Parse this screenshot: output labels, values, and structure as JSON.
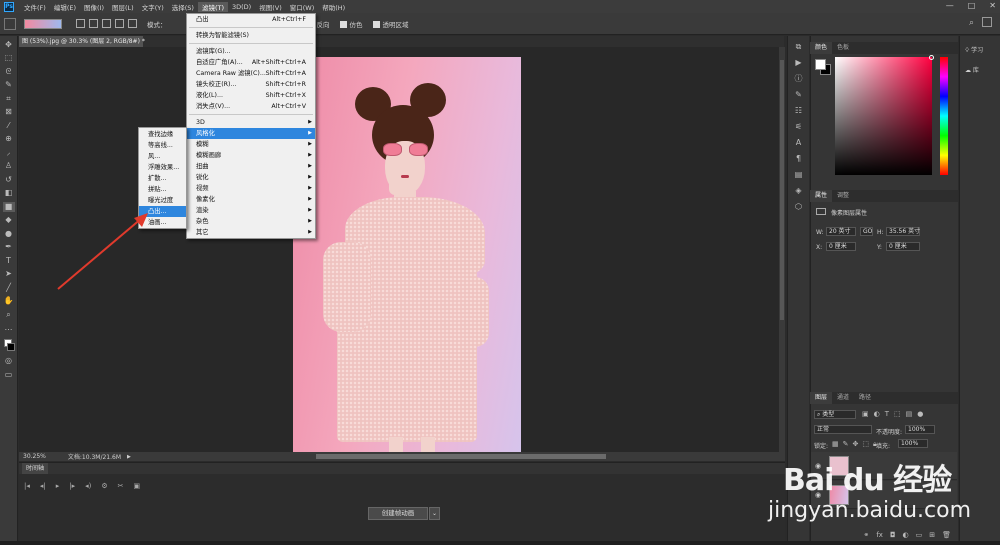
{
  "menubar": {
    "items": [
      "文件(F)",
      "编辑(E)",
      "图像(I)",
      "图层(L)",
      "文字(Y)",
      "选择(S)",
      "滤镜(T)",
      "3D(D)",
      "视图(V)",
      "窗口(W)",
      "帮助(H)"
    ],
    "active_index": 6
  },
  "window_controls": [
    "—",
    "□",
    "✕"
  ],
  "options_bar": {
    "mode_label": "模式：",
    "reverse_label": "反向",
    "dither_label": "仿色",
    "transparency_label": "透明区域"
  },
  "document": {
    "tab_title": "图 (53%).jpg @ 30.3% (图层 2, RGB/8#) *",
    "zoom": "30.25%",
    "doc_info": "文档:10.3M/21.6M"
  },
  "timeline": {
    "title": "时间轴",
    "create_label": "创建帧动画",
    "dropdown_glyph": "⌄",
    "controls": [
      "|◂",
      "◂|",
      "▸",
      "|▸",
      "◂)",
      "⚙",
      "✂",
      "▣"
    ]
  },
  "filter_menu": {
    "items": [
      {
        "label": "凸出",
        "shortcut": "Alt+Ctrl+F"
      },
      {
        "separator": true
      },
      {
        "label": "转换为智能滤镜(S)",
        "shortcut": ""
      },
      {
        "separator": true
      },
      {
        "label": "滤镜库(G)...",
        "shortcut": ""
      },
      {
        "label": "自适应广角(A)...",
        "shortcut": "Alt+Shift+Ctrl+A"
      },
      {
        "label": "Camera Raw 滤镜(C)...",
        "shortcut": "Shift+Ctrl+A"
      },
      {
        "label": "镜头校正(R)...",
        "shortcut": "Shift+Ctrl+R"
      },
      {
        "label": "液化(L)...",
        "shortcut": "Shift+Ctrl+X"
      },
      {
        "label": "消失点(V)...",
        "shortcut": "Alt+Ctrl+V"
      },
      {
        "separator": true
      },
      {
        "label": "3D",
        "submenu": true
      },
      {
        "label": "风格化",
        "submenu": true,
        "highlighted": true
      },
      {
        "label": "模糊",
        "submenu": true
      },
      {
        "label": "模糊画廊",
        "submenu": true
      },
      {
        "label": "扭曲",
        "submenu": true
      },
      {
        "label": "锐化",
        "submenu": true
      },
      {
        "label": "视频",
        "submenu": true
      },
      {
        "label": "像素化",
        "submenu": true
      },
      {
        "label": "渲染",
        "submenu": true
      },
      {
        "label": "杂色",
        "submenu": true
      },
      {
        "label": "其它",
        "submenu": true
      }
    ]
  },
  "stylize_submenu": {
    "items": [
      {
        "label": "查找边缘"
      },
      {
        "label": "等高线..."
      },
      {
        "label": "风..."
      },
      {
        "label": "浮雕效果..."
      },
      {
        "label": "扩散..."
      },
      {
        "label": "拼贴..."
      },
      {
        "label": "曝光过度"
      },
      {
        "label": "凸出...",
        "highlighted": true
      },
      {
        "label": "油画..."
      }
    ]
  },
  "color_panel": {
    "tabs": [
      "颜色",
      "色板"
    ],
    "fg_color": "#ffffff",
    "bg_color": "#000000"
  },
  "properties_panel": {
    "tabs": [
      "属性",
      "调整"
    ],
    "title": "像素图层属性",
    "w_label": "W:",
    "w_value": "20 英寸",
    "link_label": "GO",
    "h_label": "H:",
    "h_value": "35.56 英寸",
    "x_label": "X:",
    "x_value": "0 厘米",
    "y_label": "Y:",
    "y_value": "0 厘米"
  },
  "layers_panel": {
    "tabs": [
      "图层",
      "通道",
      "路径"
    ],
    "kind_label": "类型",
    "blend_mode": "正常",
    "opacity_label": "不透明度:",
    "opacity_value": "100%",
    "lock_label": "锁定:",
    "fill_label": "填充:",
    "fill_value": "100%"
  },
  "learn_panel": {
    "learn_label": "学习",
    "library_label": "库"
  },
  "watermark": {
    "brand": "Bai du 经验",
    "url": "jingyan.baidu.com"
  },
  "annotation": {
    "arrow_color": "#e03a2c"
  }
}
